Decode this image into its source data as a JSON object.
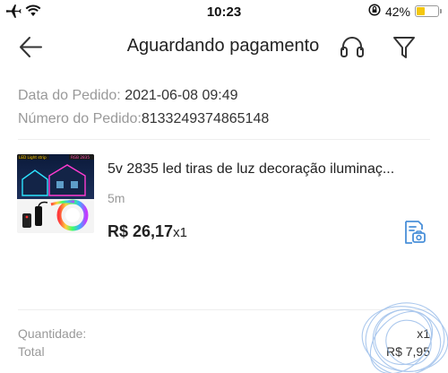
{
  "status_bar": {
    "time": "10:23",
    "battery_label": "42%",
    "battery_level": 0.42,
    "battery_color": "#f4c70f"
  },
  "header": {
    "title": "Aguardando pagamento",
    "icons": [
      "back-arrow-icon",
      "headset-icon",
      "filter-icon"
    ]
  },
  "order": {
    "date_label": "Data do Pedido:",
    "date_value": "2021-06-08 09:49",
    "number_label": "Número do Pedido:",
    "number_value": "8133249374865148"
  },
  "product": {
    "title": "5v 2835 led tiras de luz decoração iluminaç...",
    "variant": "5m",
    "price": "R$ 26,17",
    "quantity": "x1",
    "thumb_tag_left": "LED Light strip",
    "thumb_tag_right": "RGB 2835"
  },
  "summary": {
    "quantity_label": "Quantidade:",
    "quantity_value": "x1",
    "total_label": "Total",
    "total_value": "R$ 7,95"
  },
  "colors": {
    "accent_blue": "#4a90d9"
  }
}
